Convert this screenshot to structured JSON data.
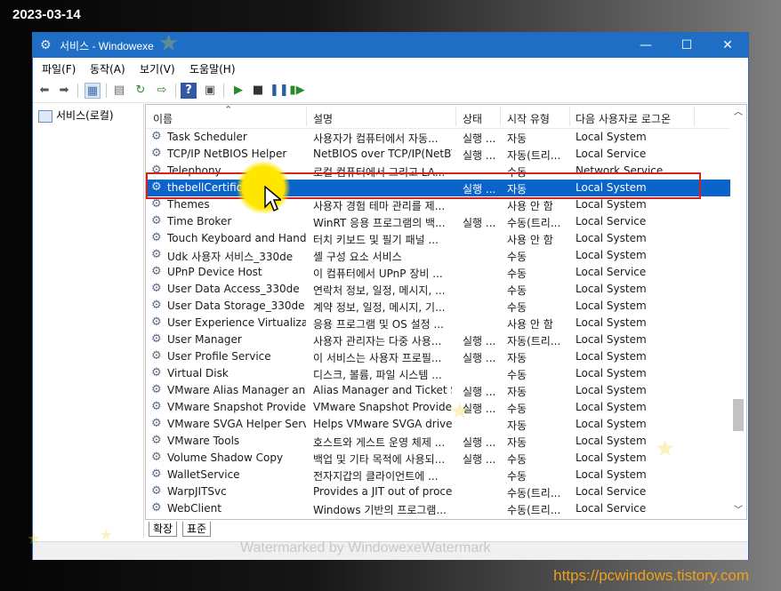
{
  "date_stamp": "2023-03-14",
  "footer_url": "https://pcwindows.tistory.com",
  "watermark": "Watermarked by WindowexeWatermark",
  "window": {
    "title": "서비스  - Windowexe",
    "controls": {
      "minimize": "—",
      "maximize": "☐",
      "close": "✕"
    }
  },
  "menu": [
    "파일(F)",
    "동작(A)",
    "보기(V)",
    "도움말(H)"
  ],
  "tree": {
    "root_label": "서비스(로컬)"
  },
  "columns": [
    "이름",
    "설명",
    "상태",
    "시작 유형",
    "다음 사용자로 로그온"
  ],
  "services": [
    {
      "name": "Task Scheduler",
      "desc": "사용자가 컴퓨터에서 자동...",
      "status": "실행 ...",
      "startup": "자동",
      "logon": "Local System"
    },
    {
      "name": "TCP/IP NetBIOS Helper",
      "desc": "NetBIOS over TCP/IP(NetBT...",
      "status": "실행 ...",
      "startup": "자동(트리...",
      "logon": "Local Service"
    },
    {
      "name": "Telephony",
      "desc": "로컬 컴퓨터에서 그리고 LA...",
      "status": "",
      "startup": "수동",
      "logon": "Network Service"
    },
    {
      "name": "thebellCertification",
      "desc": "",
      "status": "실행 ...",
      "startup": "자동",
      "logon": "Local System",
      "selected": true
    },
    {
      "name": "Themes",
      "desc": "사용자 경험 테마 관리를 제...",
      "status": "",
      "startup": "사용 안 함",
      "logon": "Local System"
    },
    {
      "name": "Time Broker",
      "desc": "WinRT 응용 프로그램의 백...",
      "status": "실행 ...",
      "startup": "수동(트리...",
      "logon": "Local Service"
    },
    {
      "name": "Touch Keyboard and Hand...",
      "desc": "터치 키보드 및 필기 패널 ...",
      "status": "",
      "startup": "사용 안 함",
      "logon": "Local System"
    },
    {
      "name": "Udk 사용자 서비스_330de",
      "desc": "셸 구성 요소 서비스",
      "status": "",
      "startup": "수동",
      "logon": "Local System"
    },
    {
      "name": "UPnP Device Host",
      "desc": "이 컴퓨터에서 UPnP 장비 ...",
      "status": "",
      "startup": "수동",
      "logon": "Local Service"
    },
    {
      "name": "User Data Access_330de",
      "desc": "연락처 정보, 일정, 메시지, ...",
      "status": "",
      "startup": "수동",
      "logon": "Local System"
    },
    {
      "name": "User Data Storage_330de",
      "desc": "계약 정보, 일정, 메시지, 기...",
      "status": "",
      "startup": "수동",
      "logon": "Local System"
    },
    {
      "name": "User Experience Virtualizati...",
      "desc": "응용 프로그램 및 OS 설정 ...",
      "status": "",
      "startup": "사용 안 함",
      "logon": "Local System"
    },
    {
      "name": "User Manager",
      "desc": "사용자 관리자는 다중 사용...",
      "status": "실행 ...",
      "startup": "자동(트리...",
      "logon": "Local System"
    },
    {
      "name": "User Profile Service",
      "desc": "이 서비스는 사용자 프로필...",
      "status": "실행 ...",
      "startup": "자동",
      "logon": "Local System"
    },
    {
      "name": "Virtual Disk",
      "desc": "디스크, 볼륨, 파일 시스템 ...",
      "status": "",
      "startup": "수동",
      "logon": "Local System"
    },
    {
      "name": "VMware Alias Manager an...",
      "desc": "Alias Manager and Ticket S...",
      "status": "실행 ...",
      "startup": "자동",
      "logon": "Local System"
    },
    {
      "name": "VMware Snapshot Provider",
      "desc": "VMware Snapshot Provider",
      "status": "실행 ...",
      "startup": "수동",
      "logon": "Local System"
    },
    {
      "name": "VMware SVGA Helper Serv...",
      "desc": "Helps VMware SVGA driver...",
      "status": "",
      "startup": "자동",
      "logon": "Local System"
    },
    {
      "name": "VMware Tools",
      "desc": "호스트와 게스트 운영 체제 ...",
      "status": "실행 ...",
      "startup": "자동",
      "logon": "Local System"
    },
    {
      "name": "Volume Shadow Copy",
      "desc": "백업 및 기타 목적에 사용되...",
      "status": "실행 ...",
      "startup": "수동",
      "logon": "Local System"
    },
    {
      "name": "WalletService",
      "desc": "전자지갑의 클라이언트에 ...",
      "status": "",
      "startup": "수동",
      "logon": "Local System"
    },
    {
      "name": "WarpJITSvc",
      "desc": "Provides a JIT out of proces...",
      "status": "",
      "startup": "수동(트리...",
      "logon": "Local Service"
    },
    {
      "name": "WebClient",
      "desc": "Windows 기반의 프로그램...",
      "status": "",
      "startup": "수동(트리...",
      "logon": "Local Service"
    }
  ],
  "tabs": [
    "확장",
    "표준"
  ]
}
